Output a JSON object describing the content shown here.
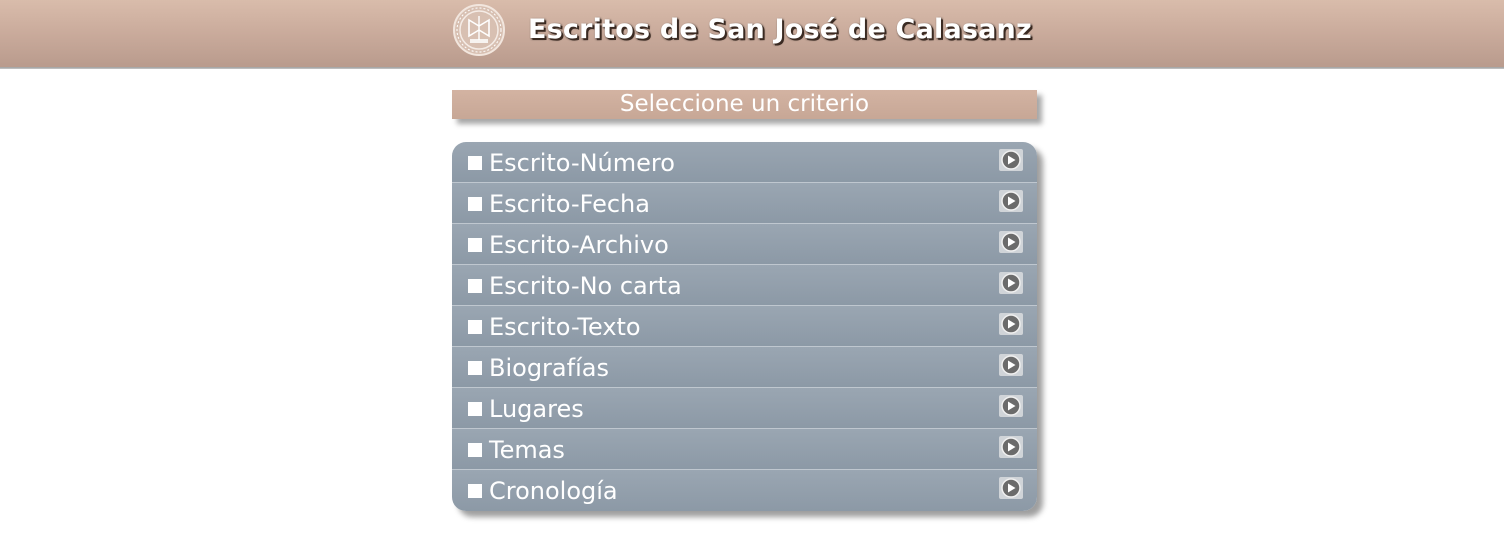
{
  "header": {
    "title": "Escritos de San José de Calasanz",
    "logo_icon": "calasanz-seal-icon"
  },
  "criterio": {
    "label": "Seleccione un criterio"
  },
  "menu": {
    "items": [
      {
        "label": "Escrito-Número"
      },
      {
        "label": "Escrito-Fecha"
      },
      {
        "label": "Escrito-Archivo"
      },
      {
        "label": "Escrito-No carta"
      },
      {
        "label": "Escrito-Texto"
      },
      {
        "label": "Biografías"
      },
      {
        "label": "Lugares"
      },
      {
        "label": "Temas"
      },
      {
        "label": "Cronología"
      }
    ],
    "bullet_icon": "square-bullet-icon",
    "arrow_icon": "play-arrow-icon"
  },
  "colors": {
    "header": "#c8a99a",
    "menu": "#929fab",
    "text": "#ffffff"
  }
}
